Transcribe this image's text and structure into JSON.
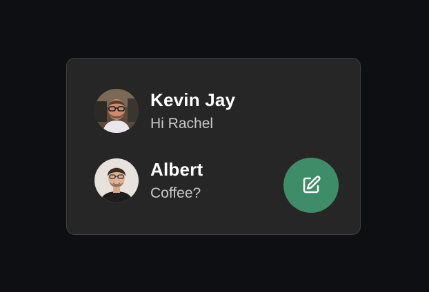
{
  "conversations": [
    {
      "name": "Kevin Jay",
      "message": "Hi Rachel",
      "avatar_icon": "kevin-avatar"
    },
    {
      "name": "Albert",
      "message": "Coffee?",
      "avatar_icon": "albert-avatar"
    }
  ],
  "compose": {
    "icon": "edit-icon",
    "color": "#3f8d68"
  },
  "colors": {
    "background": "#0d0f13",
    "card": "#262626",
    "card_border": "#3f3f3f",
    "name_text": "#ffffff",
    "message_text": "#c9c9c9"
  }
}
